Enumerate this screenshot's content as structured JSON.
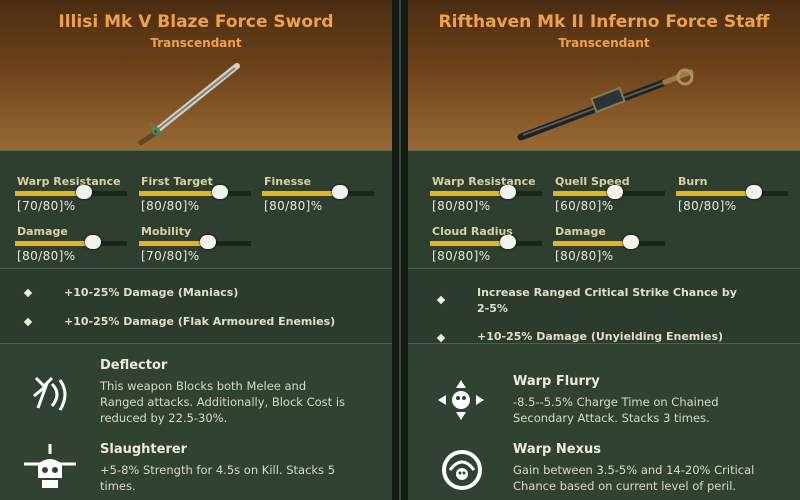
{
  "left": {
    "title": "Illisi Mk V Blaze Force Sword",
    "rarity": "Transcendant",
    "weapon_icon": "force-sword",
    "stats": [
      {
        "label": "Warp Resistance",
        "value": "[70/80]%",
        "level": 0.62
      },
      {
        "label": "First Target",
        "value": "[80/80]%",
        "level": 0.72
      },
      {
        "label": "Finesse",
        "value": "[80/80]%",
        "level": 0.7
      },
      {
        "label": "Damage",
        "value": "[80/80]%",
        "level": 0.7
      },
      {
        "label": "Mobility",
        "value": "[70/80]%",
        "level": 0.62
      }
    ],
    "blessings": [
      "+10-25% Damage (Maniacs)",
      "+10-25% Damage (Flak Armoured Enemies)"
    ],
    "perks": [
      {
        "title": "Deflector",
        "icon": "deflector-icon",
        "lines": [
          "This weapon Blocks both Melee and",
          "Ranged attacks. Additionally, Block Cost is",
          "reduced by 22.5-30%."
        ]
      },
      {
        "title": "Slaughterer",
        "icon": "skull-icon",
        "lines": [
          "+5-8% Strength for 4.5s on Kill. Stacks 5",
          "times."
        ]
      }
    ]
  },
  "right": {
    "title": "Rifthaven Mk II Inferno Force Staff",
    "rarity": "Transcendant",
    "weapon_icon": "force-staff",
    "stats": [
      {
        "label": "Warp Resistance",
        "value": "[80/80]%",
        "level": 0.7
      },
      {
        "label": "Quell Speed",
        "value": "[60/80]%",
        "level": 0.55
      },
      {
        "label": "Burn",
        "value": "[80/80]%",
        "level": 0.7
      },
      {
        "label": "Cloud Radius",
        "value": "[80/80]%",
        "level": 0.7
      },
      {
        "label": "Damage",
        "value": "[80/80]%",
        "level": 0.7
      }
    ],
    "blessings": [
      [
        "Increase Ranged Critical Strike Chance by",
        "2-5%"
      ],
      [
        "+10-25% Damage (Unyielding Enemies)"
      ]
    ],
    "perks": [
      {
        "title": "Warp Flurry",
        "icon": "warp-flurry-icon",
        "lines": [
          "-8.5--5.5% Charge Time on Chained",
          "Secondary Attack. Stacks 3 times."
        ]
      },
      {
        "title": "Warp Nexus",
        "icon": "warp-nexus-icon",
        "lines": [
          "Gain between 3.5-5% and 14-20% Critical",
          "Chance based on current level of peril."
        ]
      }
    ]
  },
  "colors": {
    "accent": "#f0a04a",
    "bar": "#e8b21a",
    "panel": "#2e3e2f"
  }
}
